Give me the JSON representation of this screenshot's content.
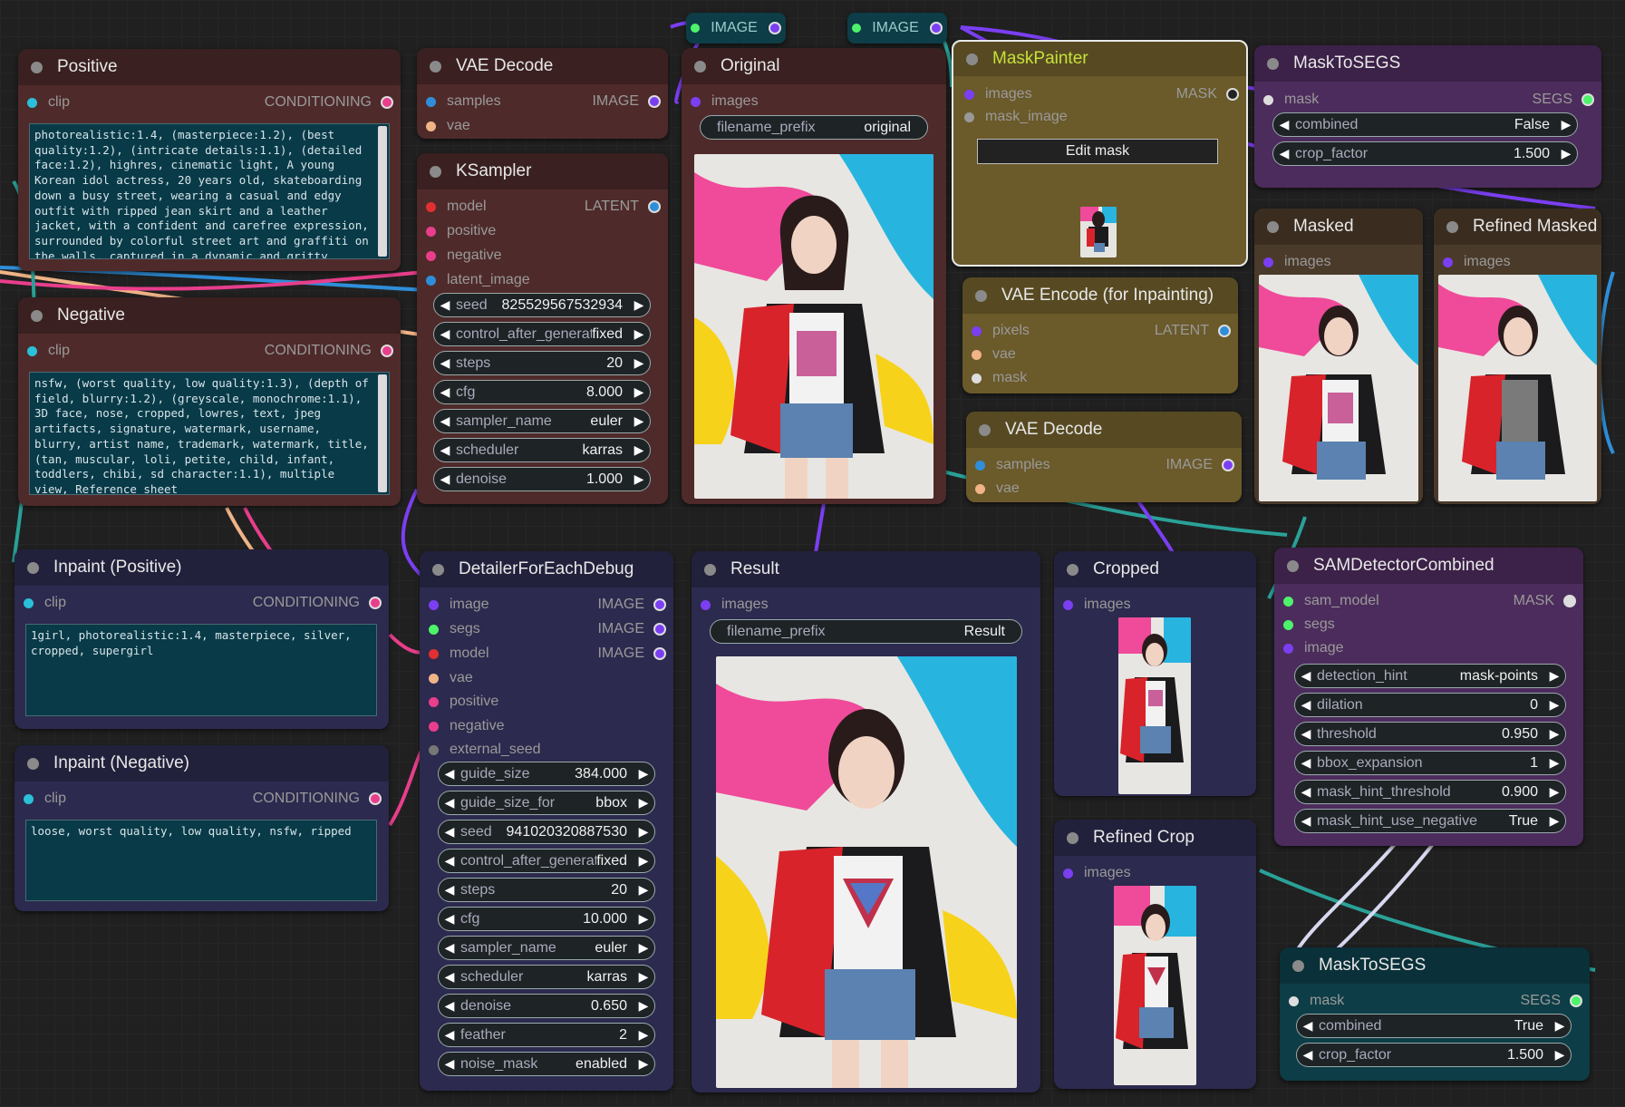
{
  "colors": {
    "wire_purple": "#7b3ff2",
    "wire_teal": "#2aa198",
    "wire_pink": "#e83e8c",
    "wire_blue": "#2f8ed9",
    "wire_orange": "#f0b487"
  },
  "reroute": {
    "left": "IMAGE",
    "right": "IMAGE"
  },
  "positive": {
    "title": "Positive",
    "in_clip": "clip",
    "out": "CONDITIONING",
    "text": "photorealistic:1.4, (masterpiece:1.2), (best quality:1.2), (intricate details:1.1), (detailed face:1.2), highres, cinematic light, A young Korean idol actress, 20 years old, skateboarding down a busy street, wearing a casual and edgy outfit with ripped jean skirt and a leather jacket, with a confident and carefree expression, surrounded by colorful street art and graffiti on the walls, captured in a dynamic and gritty"
  },
  "negative": {
    "title": "Negative",
    "in_clip": "clip",
    "out": "CONDITIONING",
    "text": "nsfw, (worst quality, low quality:1.3), (depth of field, blurry:1.2), (greyscale, monochrome:1.1), 3D face, nose, cropped, lowres, text, jpeg artifacts, signature, watermark, username, blurry, artist name, trademark, watermark, title, (tan, muscular, loli, petite, child, infant, toddlers, chibi, sd character:1.1), multiple view, Reference sheet"
  },
  "vae_decode1": {
    "title": "VAE Decode",
    "in1": "samples",
    "in2": "vae",
    "out": "IMAGE"
  },
  "ksampler": {
    "title": "KSampler",
    "inputs": [
      "model",
      "positive",
      "negative",
      "latent_image"
    ],
    "out": "LATENT",
    "widgets": [
      {
        "n": "seed",
        "v": "825529567532934"
      },
      {
        "n": "control_after_generate",
        "v": "fixed"
      },
      {
        "n": "steps",
        "v": "20"
      },
      {
        "n": "cfg",
        "v": "8.000"
      },
      {
        "n": "sampler_name",
        "v": "euler"
      },
      {
        "n": "scheduler",
        "v": "karras"
      },
      {
        "n": "denoise",
        "v": "1.000"
      }
    ]
  },
  "original": {
    "title": "Original",
    "in": "images",
    "wname": "filename_prefix",
    "wval": "original"
  },
  "maskpainter": {
    "title": "MaskPainter",
    "in1": "images",
    "in2": "mask_image",
    "out": "MASK",
    "button": "Edit mask"
  },
  "masktosegs1": {
    "title": "MaskToSEGS",
    "in": "mask",
    "out": "SEGS",
    "widgets": [
      {
        "n": "combined",
        "v": "False"
      },
      {
        "n": "crop_factor",
        "v": "1.500"
      }
    ]
  },
  "masked": {
    "title": "Masked",
    "in": "images"
  },
  "refined_masked": {
    "title": "Refined Masked",
    "in": "images"
  },
  "vae_encode": {
    "title": "VAE Encode (for Inpainting)",
    "in1": "pixels",
    "in2": "vae",
    "in3": "mask",
    "out": "LATENT"
  },
  "vae_decode2": {
    "title": "VAE Decode",
    "in1": "samples",
    "in2": "vae",
    "out": "IMAGE"
  },
  "inpaint_pos": {
    "title": "Inpaint (Positive)",
    "in_clip": "clip",
    "out": "CONDITIONING",
    "text": "1girl, photorealistic:1.4, masterpiece, silver, cropped, supergirl"
  },
  "inpaint_neg": {
    "title": "Inpaint (Negative)",
    "in_clip": "clip",
    "out": "CONDITIONING",
    "text": "loose, worst quality, low quality, nsfw, ripped"
  },
  "detailer": {
    "title": "DetailerForEachDebug",
    "inputs": [
      "image",
      "segs",
      "model",
      "vae",
      "positive",
      "negative",
      "external_seed"
    ],
    "outs": [
      "IMAGE",
      "IMAGE",
      "IMAGE"
    ],
    "widgets": [
      {
        "n": "guide_size",
        "v": "384.000"
      },
      {
        "n": "guide_size_for",
        "v": "bbox"
      },
      {
        "n": "seed",
        "v": "941020320887530"
      },
      {
        "n": "control_after_generate",
        "v": "fixed"
      },
      {
        "n": "steps",
        "v": "20"
      },
      {
        "n": "cfg",
        "v": "10.000"
      },
      {
        "n": "sampler_name",
        "v": "euler"
      },
      {
        "n": "scheduler",
        "v": "karras"
      },
      {
        "n": "denoise",
        "v": "0.650"
      },
      {
        "n": "feather",
        "v": "2"
      },
      {
        "n": "noise_mask",
        "v": "enabled"
      }
    ]
  },
  "result": {
    "title": "Result",
    "in": "images",
    "wname": "filename_prefix",
    "wval": "Result"
  },
  "cropped": {
    "title": "Cropped",
    "in": "images"
  },
  "refined_crop": {
    "title": "Refined Crop",
    "in": "images"
  },
  "sam": {
    "title": "SAMDetectorCombined",
    "inputs": [
      "sam_model",
      "segs",
      "image"
    ],
    "out": "MASK",
    "widgets": [
      {
        "n": "detection_hint",
        "v": "mask-points"
      },
      {
        "n": "dilation",
        "v": "0"
      },
      {
        "n": "threshold",
        "v": "0.950"
      },
      {
        "n": "bbox_expansion",
        "v": "1"
      },
      {
        "n": "mask_hint_threshold",
        "v": "0.900"
      },
      {
        "n": "mask_hint_use_negative",
        "v": "True"
      }
    ]
  },
  "masktosegs2": {
    "title": "MaskToSEGS",
    "in": "mask",
    "out": "SEGS",
    "widgets": [
      {
        "n": "combined",
        "v": "True"
      },
      {
        "n": "crop_factor",
        "v": "1.500"
      }
    ]
  }
}
